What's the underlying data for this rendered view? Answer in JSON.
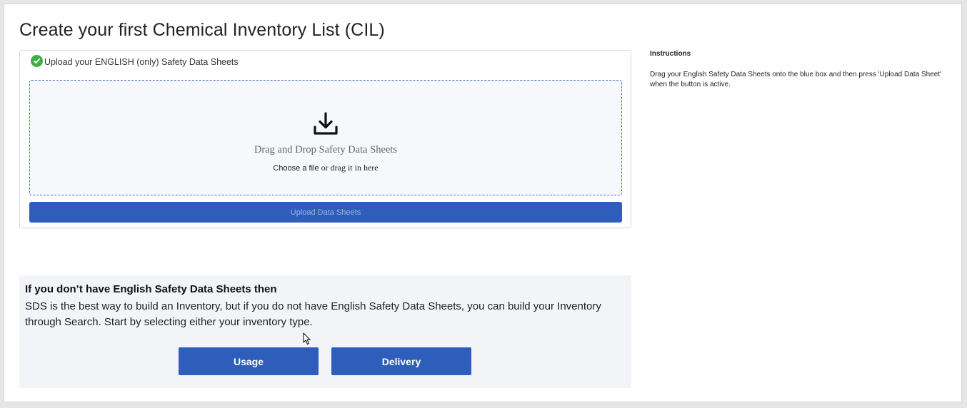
{
  "page": {
    "title": "Create your first Chemical Inventory List (CIL)"
  },
  "upload": {
    "header_label": "Upload your ENGLISH (only) Safety Data Sheets",
    "header_icon": "check-circle-icon",
    "dropzone": {
      "icon": "download-icon",
      "title": "Drag and Drop Safety Data Sheets",
      "choose_text": "Choose a file",
      "drag_text": "or drag it in here"
    },
    "button_label": "Upload Data Sheets"
  },
  "instructions": {
    "heading": "Instructions",
    "body": "Drag your English Safety Data Sheets onto the blue box and then press 'Upload Data Sheet' when the button is active."
  },
  "alternative": {
    "title": "If you don’t have English Safety Data Sheets then",
    "text": "SDS is the best way to build an Inventory, but if you do not have English Safety Data Sheets, you can build your Inventory through Search. Start by selecting either your inventory type.",
    "usage_label": "Usage",
    "delivery_label": "Delivery"
  },
  "colors": {
    "primary": "#2e5dbb",
    "success": "#3cb043",
    "dropzone_border": "#4a6fb5",
    "panel_bg": "#f3f4f8"
  }
}
